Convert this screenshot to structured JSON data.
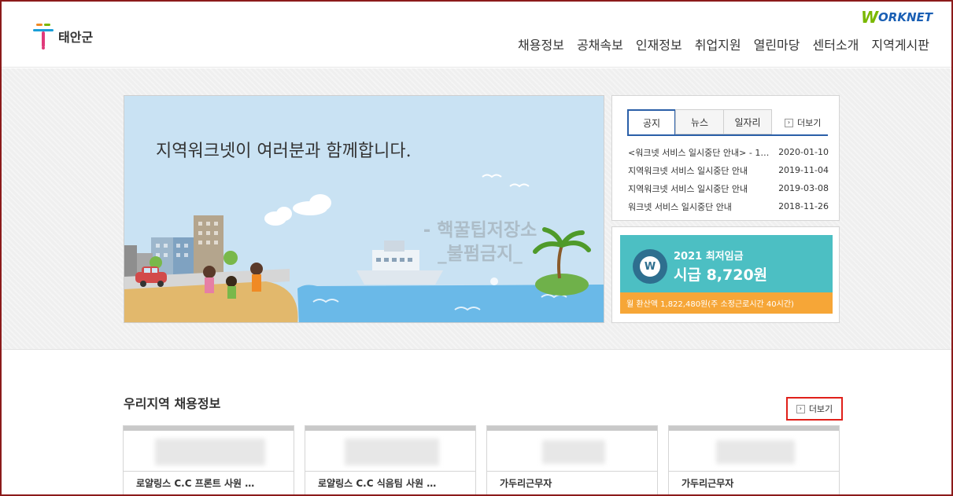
{
  "header": {
    "logo_text": "태안군",
    "worknet_w": "W",
    "worknet_rest": "ORKNET",
    "nav": [
      "채용정보",
      "공채속보",
      "인재정보",
      "취업지원",
      "열린마당",
      "센터소개",
      "지역게시판"
    ]
  },
  "banner": {
    "headline": "지역워크넷이 여러분과 함께합니다.",
    "watermark_line1": "- 핵꿀팁저장소",
    "watermark_line2": "_불펌금지_"
  },
  "notice": {
    "tabs": [
      "공지",
      "뉴스",
      "일자리"
    ],
    "more_label": "더보기",
    "items": [
      {
        "title": "<워크넷 서비스 일시중단 안내> - 1…",
        "date": "2020-01-10"
      },
      {
        "title": "지역워크넷 서비스 일시중단 안내",
        "date": "2019-11-04"
      },
      {
        "title": "지역워크넷 서비스 일시중단 안내",
        "date": "2019-03-08"
      },
      {
        "title": "워크넷 서비스 일시중단 안내",
        "date": "2018-11-26"
      }
    ]
  },
  "wage": {
    "coin_label": "W",
    "title": "2021 최저임금",
    "amount": "시급 8,720원",
    "monthly": "월 환산액 1,822,480원(주 소정근로시간 40시간)"
  },
  "jobs": {
    "title": "우리지역 채용정보",
    "more_label": "더보기",
    "cards": [
      {
        "title": "로얄링스 C.C 프론트 사원 …"
      },
      {
        "title": "로얄링스 C.C 식음팀 사원 …"
      },
      {
        "title": "가두리근무자"
      },
      {
        "title": "가두리근무자"
      }
    ]
  },
  "colors": {
    "frame": "#8b1a1a",
    "tab_active": "#2a5fa8",
    "wage_top": "#4cbfc3",
    "wage_bottom": "#f6a637",
    "highlight": "#e0201a"
  }
}
